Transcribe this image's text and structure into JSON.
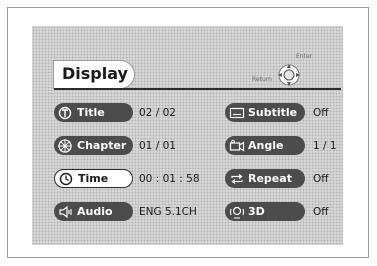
{
  "menu": {
    "title": "Display",
    "hints": {
      "enter": "Enter",
      "return": "Return"
    }
  },
  "left_rows": [
    {
      "label": "Title",
      "value": "02 / 02",
      "icon": "title-icon",
      "active": false
    },
    {
      "label": "Chapter",
      "value": "01 / 01",
      "icon": "chapter-icon",
      "active": false
    },
    {
      "label": "Time",
      "value": "00 : 01 : 58",
      "icon": "time-icon",
      "active": true
    },
    {
      "label": "Audio",
      "value": "ENG 5.1CH",
      "icon": "audio-icon",
      "active": false
    }
  ],
  "right_rows": [
    {
      "label": "Subtitle",
      "value": "Off",
      "icon": "subtitle-icon"
    },
    {
      "label": "Angle",
      "value": "1 / 1",
      "icon": "angle-icon"
    },
    {
      "label": "Repeat",
      "value": "Off",
      "icon": "repeat-icon"
    },
    {
      "label": "3D",
      "value": "Off",
      "icon": "3d-sound-icon"
    }
  ],
  "colors": {
    "pill": "#4c4c4c",
    "pill_active": "#ffffff",
    "panel": "#cdcdcd"
  }
}
